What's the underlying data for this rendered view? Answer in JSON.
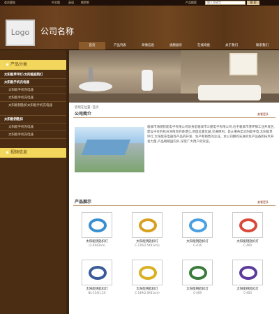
{
  "topbar": {
    "fav": "会员登陆",
    "lang1": "中文版",
    "lang2": "英语",
    "lang3": "俄罗斯",
    "search_label": "产品搜索",
    "search_placeholder": "输入关键字",
    "search_button": "搜 索"
  },
  "header": {
    "logo": "Logo",
    "company": "公司名称"
  },
  "nav": [
    "首页",
    "产品列表",
    "商情信息",
    "视频展示",
    "在线询盘",
    "关于我们",
    "联系我们"
  ],
  "sidebar": {
    "cat_title": "产品分类",
    "items": [
      {
        "label": "太阳能草坪灯/太阳能庭院灯",
        "bold": true
      },
      {
        "label": "太阳能手机充电器",
        "bold": true
      },
      {
        "label": "太阳能手机充电器",
        "sub": true
      },
      {
        "label": "太阳能手机充电器",
        "sub": true
      },
      {
        "label": "太阳能钥匙扣太阳能手机充电器",
        "sub": true,
        "tall": true
      },
      {
        "label": "太阳能钥匙扣",
        "bold": true
      },
      {
        "label": "太阳能手机充电器",
        "sub": true
      },
      {
        "label": "太阳能手机充电器",
        "sub": true
      }
    ],
    "video_title": "视频信息"
  },
  "main": {
    "breadcrumb": "您现在位置: 首页",
    "intro_title": "公司简介",
    "intro_more": "查看更多",
    "intro_text": "临溪市海储智能电子有限公司前身是临溪市三捷电子有限公司,位于临溪市港环镇工业开发区,建设于在的杭州湾南岸的香港立,地理位置优越,交通便利。是从事各类太阳能手电,太阳能草坪灯,太阳能充电器等产品的开发、生产和销售的企业。本公司拥有先进的生产设备和技术开发力量,产品畅销国内外,深受广大用户的欢迎。",
    "products_title": "产品展示",
    "products_more": "查看更多",
    "products": [
      {
        "name": "太阳能钥匙扣灯",
        "code": "(2.0X43cm)"
      },
      {
        "name": "太阳能钥匙扣灯",
        "code": "C-176(2.5X41cm)"
      },
      {
        "name": "太阳能钥匙扣灯",
        "code": "C-414"
      },
      {
        "name": "太阳能钥匙扣灯",
        "code": "C-400"
      },
      {
        "name": "太阳能钥匙扣灯",
        "code": "NL-154(1.5X"
      },
      {
        "name": "太阳能钥匙扣灯",
        "code": "C-149(2.0X41cm)"
      },
      {
        "name": "太阳能钥匙扣灯",
        "code": "C-409"
      },
      {
        "name": "太阳能钥匙扣灯",
        "code": "C-403"
      }
    ]
  }
}
